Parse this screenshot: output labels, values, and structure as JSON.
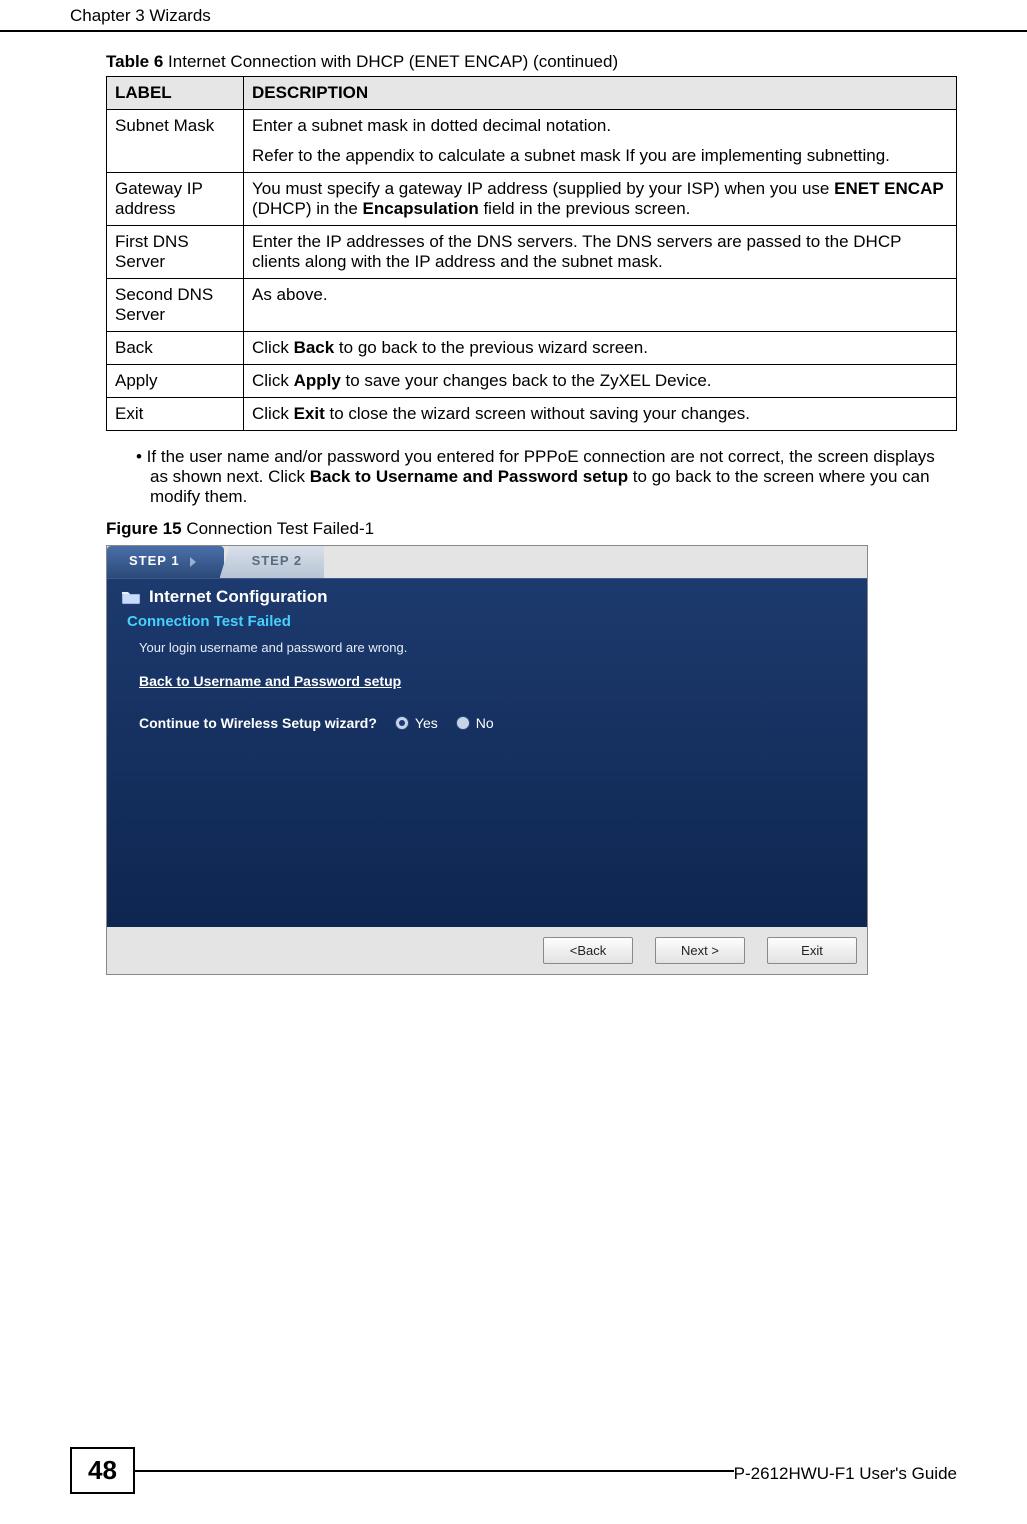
{
  "header": {
    "chapter": "Chapter 3 Wizards"
  },
  "table": {
    "title_prefix": "Table 6",
    "title_rest": "   Internet Connection with DHCP (ENET ENCAP) (continued)",
    "headers": {
      "label": "LABEL",
      "description": "DESCRIPTION"
    },
    "rows": [
      {
        "label": "Subnet Mask",
        "desc_line1": "Enter a subnet mask in dotted decimal notation.",
        "desc_line2": "Refer to the appendix to calculate a subnet mask If you are implementing subnetting."
      },
      {
        "label": "Gateway IP address",
        "desc_pre": "You must specify a gateway IP address (supplied by your ISP) when you use ",
        "desc_b1": "ENET ENCAP",
        "desc_mid": " (DHCP) in the ",
        "desc_b2": "Encapsulation",
        "desc_post": " field in the previous screen."
      },
      {
        "label": "First DNS Server",
        "desc": "Enter the IP addresses of the DNS servers. The DNS servers are passed to the DHCP clients along with the IP address and the subnet mask."
      },
      {
        "label": "Second DNS Server",
        "desc": "As above."
      },
      {
        "label": "Back",
        "desc_pre": "Click ",
        "desc_b1": "Back",
        "desc_post": " to go back to the previous wizard screen."
      },
      {
        "label": "Apply",
        "desc_pre": "Click ",
        "desc_b1": "Apply",
        "desc_post": " to save your changes back to the ZyXEL Device."
      },
      {
        "label": "Exit",
        "desc_pre": "Click ",
        "desc_b1": "Exit",
        "desc_post": " to close the wizard screen without saving your changes."
      }
    ]
  },
  "bullet": {
    "pre": "• If the user name and/or password you entered for PPPoE connection are not correct, the screen displays as shown next. Click ",
    "b": "Back to Username and Password setup",
    "post": " to go back to the screen where you can modify them."
  },
  "figure": {
    "title_prefix": "Figure 15",
    "title_rest": "   Connection Test Failed-1",
    "step1": "STEP 1",
    "step2": "STEP 2",
    "panel_header": "Internet Configuration",
    "ctf": "Connection Test Failed",
    "ctf_msg": "Your login username and password are wrong.",
    "ctf_link": "Back to Username and Password setup",
    "wireless_q": "Continue to Wireless Setup wizard?",
    "yes": "Yes",
    "no": "No",
    "btn_back": "<Back",
    "btn_next": "Next >",
    "btn_exit": "Exit"
  },
  "footer": {
    "page_number": "48",
    "guide": "P-2612HWU-F1 User's Guide"
  }
}
